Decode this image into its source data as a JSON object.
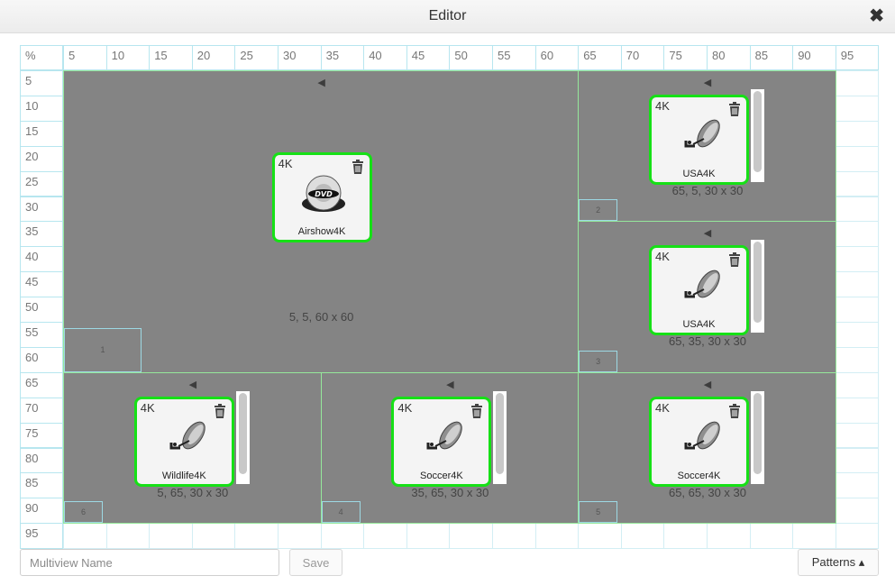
{
  "window": {
    "title": "Editor",
    "close_icon": "close-icon"
  },
  "grid": {
    "corner_label": "%",
    "columns": [
      "5",
      "10",
      "15",
      "20",
      "25",
      "30",
      "35",
      "40",
      "45",
      "50",
      "55",
      "60",
      "65",
      "70",
      "75",
      "80",
      "85",
      "90",
      "95"
    ],
    "rows": [
      "5",
      "10",
      "15",
      "20",
      "25",
      "30",
      "35",
      "40",
      "45",
      "50",
      "55",
      "60",
      "65",
      "70",
      "75",
      "80",
      "85",
      "90",
      "95"
    ]
  },
  "windows": [
    {
      "number": "1",
      "dims": "5, 5, 60 x 60",
      "source": {
        "resolution": "4K",
        "name": "Airshow4K",
        "icon": "dvd-icon"
      }
    },
    {
      "number": "2",
      "dims": "65, 5, 30 x 30",
      "source": {
        "resolution": "4K",
        "name": "USA4K",
        "icon": "satellite-dish-icon"
      }
    },
    {
      "number": "3",
      "dims": "65, 35, 30 x 30",
      "source": {
        "resolution": "4K",
        "name": "USA4K",
        "icon": "satellite-dish-icon"
      }
    },
    {
      "number": "6",
      "dims": "5, 65, 30 x 30",
      "source": {
        "resolution": "4K",
        "name": "Wildlife4K",
        "icon": "satellite-dish-icon"
      }
    },
    {
      "number": "4",
      "dims": "35, 65, 30 x 30",
      "source": {
        "resolution": "4K",
        "name": "Soccer4K",
        "icon": "satellite-dish-icon"
      }
    },
    {
      "number": "5",
      "dims": "65, 65, 30 x 30",
      "source": {
        "resolution": "4K",
        "name": "Soccer4K",
        "icon": "satellite-dish-icon"
      }
    }
  ],
  "footer": {
    "name_placeholder": "Multiview Name",
    "name_value": "",
    "save_label": "Save",
    "patterns_label": "Patterns ▴"
  },
  "colors": {
    "window_bg": "#848484",
    "window_border": "#95e89b",
    "source_border": "#16e016",
    "grid_line": "#b7e6ef"
  }
}
